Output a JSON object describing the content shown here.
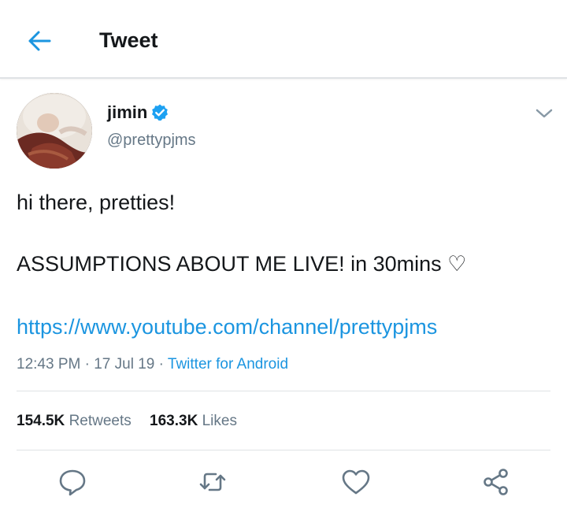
{
  "header": {
    "title": "Tweet",
    "back_icon": "arrow-left-icon"
  },
  "tweet": {
    "author": {
      "display_name": "jimin",
      "handle": "@prettypjms",
      "verified": true
    },
    "text_line1": "hi there, pretties!",
    "text_line2": "ASSUMPTIONS ABOUT ME LIVE! in 30mins ♡",
    "link": "https://www.youtube.com/channel/prettypjms",
    "time": "12:43 PM",
    "date": "17 Jul 19",
    "source": "Twitter for Android",
    "separator": "·"
  },
  "stats": {
    "retweets_count": "154.5K",
    "retweets_label": "Retweets",
    "likes_count": "163.3K",
    "likes_label": "Likes"
  },
  "actions": [
    "reply-icon",
    "retweet-icon",
    "like-icon",
    "share-icon"
  ],
  "colors": {
    "accent": "#1b95e0",
    "text": "#14171a",
    "secondary": "#657786",
    "divider": "#dfe2e5"
  }
}
